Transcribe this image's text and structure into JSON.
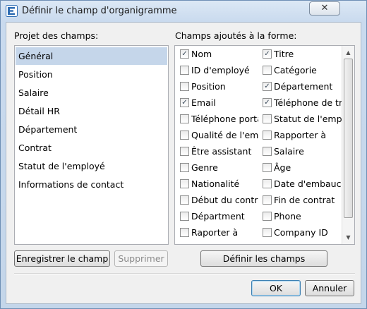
{
  "window": {
    "title": "Définir le champ d'organigramme",
    "close_symbol": "✕"
  },
  "left_panel": {
    "label": "Projet des champs:",
    "items": [
      "Général",
      "Position",
      "Salaire",
      "Détail HR",
      "Département",
      "Contrat",
      "Statut de l'employé",
      "Informations de contact"
    ],
    "selected_index": 0
  },
  "right_panel": {
    "label": "Champs ajoutés à la forme:",
    "fields_left": [
      {
        "label": "Nom",
        "checked": true
      },
      {
        "label": "ID d'employé",
        "checked": false
      },
      {
        "label": "Position",
        "checked": false
      },
      {
        "label": "Email",
        "checked": true
      },
      {
        "label": "Téléphone portable",
        "checked": false
      },
      {
        "label": "Qualité de l'employé",
        "checked": false
      },
      {
        "label": "Être assistant",
        "checked": false
      },
      {
        "label": "Genre",
        "checked": false
      },
      {
        "label": "Nationalité",
        "checked": false
      },
      {
        "label": "Début du contrat",
        "checked": false
      },
      {
        "label": "Départment",
        "checked": false
      },
      {
        "label": "Raporter à",
        "checked": false
      }
    ],
    "fields_right": [
      {
        "label": "Titre",
        "checked": true
      },
      {
        "label": "Catégorie",
        "checked": false
      },
      {
        "label": "Département",
        "checked": true
      },
      {
        "label": "Téléphone de travail",
        "checked": true
      },
      {
        "label": "Statut de l'employé",
        "checked": false
      },
      {
        "label": "Rapporter à",
        "checked": false
      },
      {
        "label": "Salaire",
        "checked": false
      },
      {
        "label": "Âge",
        "checked": false
      },
      {
        "label": "Date d'embauche",
        "checked": false
      },
      {
        "label": "Fin de contrat",
        "checked": false
      },
      {
        "label": "Phone",
        "checked": false
      },
      {
        "label": "Company ID",
        "checked": false
      }
    ],
    "check_symbol": "✓",
    "scroll_up_symbol": "▲",
    "scroll_down_symbol": "▼"
  },
  "buttons": {
    "save_field": "Enregistrer le champ",
    "delete": "Supprimer",
    "define_fields": "Définir les champs",
    "ok": "OK",
    "cancel": "Annuler"
  }
}
